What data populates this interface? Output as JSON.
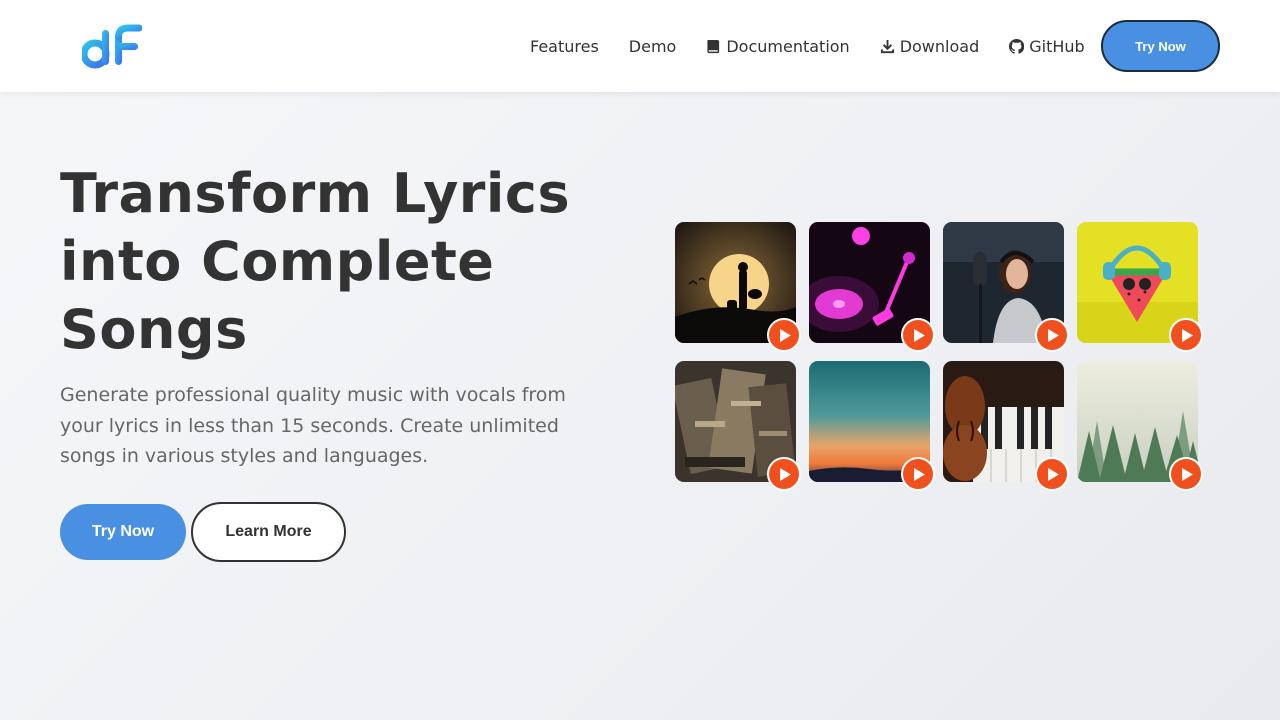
{
  "brand": {
    "logo_icon": "df-logo-icon",
    "colors": {
      "primary": "#4a90e2",
      "play": "#f0501e",
      "text": "#333333",
      "muted": "#666666"
    }
  },
  "nav": {
    "links": [
      {
        "label": "Features",
        "icon": ""
      },
      {
        "label": "Demo",
        "icon": ""
      },
      {
        "label": "Documentation",
        "icon": "book-icon"
      },
      {
        "label": "Download",
        "icon": "download-icon"
      },
      {
        "label": "GitHub",
        "icon": "github-icon"
      }
    ],
    "cta_label": "Try Now"
  },
  "hero": {
    "title": "Transform Lyrics into Complete Songs",
    "subtitle": "Generate professional quality music with vocals from your lyrics in less than 15 seconds. Create unlimited songs in various styles and languages.",
    "primary_label": "Try Now",
    "secondary_label": "Learn More"
  },
  "gallery": {
    "cards": [
      {
        "art": "sunset-guitarist-art",
        "play_icon": "play-icon"
      },
      {
        "art": "neon-vinyl-art",
        "play_icon": "play-icon"
      },
      {
        "art": "singer-studio-art",
        "play_icon": "play-icon"
      },
      {
        "art": "watermelon-headphones-art",
        "play_icon": "play-icon"
      },
      {
        "art": "record-stack-art",
        "play_icon": "play-icon"
      },
      {
        "art": "sunset-sky-art",
        "play_icon": "play-icon"
      },
      {
        "art": "violin-piano-art",
        "play_icon": "play-icon"
      },
      {
        "art": "misty-forest-art",
        "play_icon": "play-icon"
      }
    ]
  }
}
